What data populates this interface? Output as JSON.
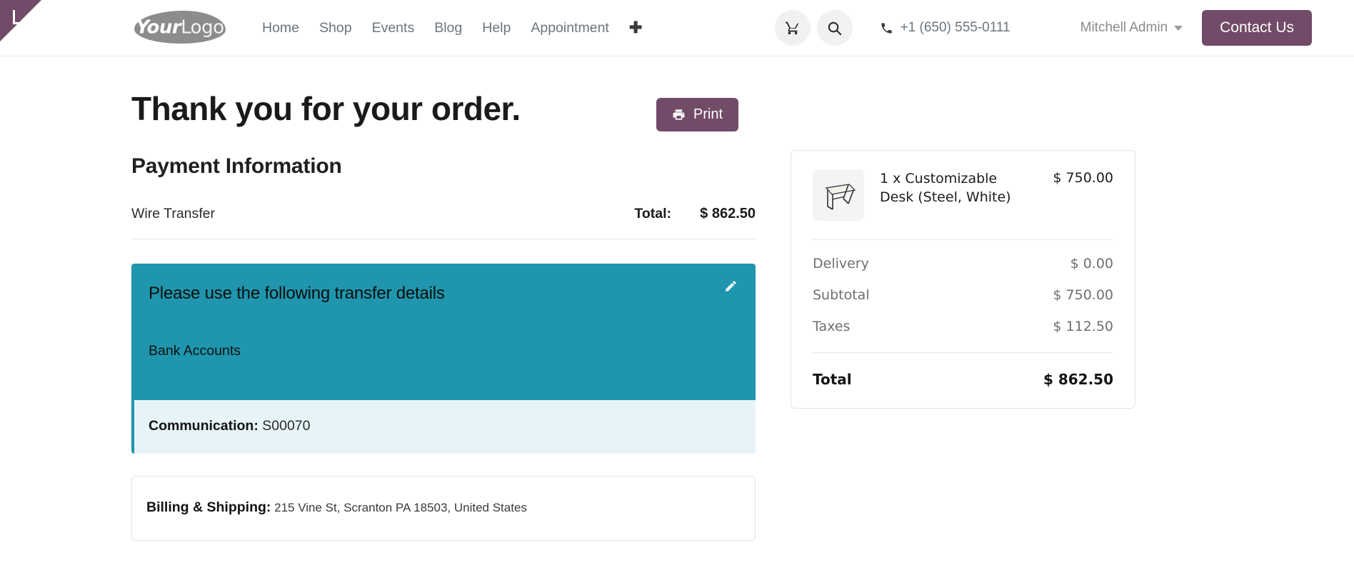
{
  "header": {
    "logo": {
      "part1": "Your",
      "part2": "Logo"
    },
    "nav": [
      {
        "label": "Home"
      },
      {
        "label": "Shop"
      },
      {
        "label": "Events"
      },
      {
        "label": "Blog"
      },
      {
        "label": "Help"
      },
      {
        "label": "Appointment"
      }
    ],
    "add_page_icon": "plus-icon",
    "cart_icon": "shopping-cart-icon",
    "search_icon": "search-icon",
    "phone_icon": "phone-icon",
    "phone": "+1 (650) 555-0111",
    "user": "Mitchell Admin",
    "user_caret_icon": "chevron-down-icon",
    "contact_button": "Contact Us",
    "brand_purple": "#714B67"
  },
  "main": {
    "title": "Thank you for your order.",
    "print_button": "Print",
    "print_icon": "printer-icon",
    "payment_section_title": "Payment Information",
    "payment_method": "Wire Transfer",
    "total_label": "Total:",
    "total_value": "$ 862.50",
    "transfer": {
      "title": "Please use the following transfer details",
      "bank_accounts_label": "Bank Accounts",
      "edit_icon": "pencil-icon",
      "panel_color": "#1F96AD",
      "communication_label": "Communication:",
      "communication_value": "S00070"
    },
    "billing": {
      "label": "Billing & Shipping:",
      "address": "215 Vine St, Scranton PA 18503, United States"
    }
  },
  "summary": {
    "item": {
      "name": "1 x Customizable Desk (Steel, White)",
      "price": "$ 750.00",
      "thumb_icon": "desk-product-image"
    },
    "lines": [
      {
        "label": "Delivery",
        "value": "$ 0.00"
      },
      {
        "label": "Subtotal",
        "value": "$ 750.00"
      },
      {
        "label": "Taxes",
        "value": "$ 112.50"
      }
    ],
    "grand_total_label": "Total",
    "grand_total_value": "$ 862.50"
  }
}
